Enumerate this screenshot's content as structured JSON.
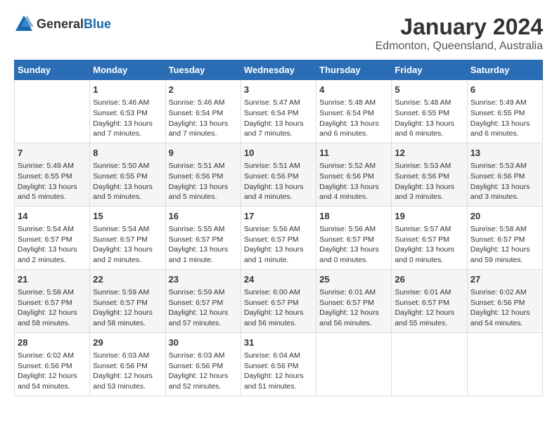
{
  "header": {
    "logo_general": "General",
    "logo_blue": "Blue",
    "title": "January 2024",
    "subtitle": "Edmonton, Queensland, Australia"
  },
  "calendar": {
    "days_of_week": [
      "Sunday",
      "Monday",
      "Tuesday",
      "Wednesday",
      "Thursday",
      "Friday",
      "Saturday"
    ],
    "weeks": [
      [
        {
          "day": "",
          "info": ""
        },
        {
          "day": "1",
          "info": "Sunrise: 5:46 AM\nSunset: 6:53 PM\nDaylight: 13 hours\nand 7 minutes."
        },
        {
          "day": "2",
          "info": "Sunrise: 5:46 AM\nSunset: 6:54 PM\nDaylight: 13 hours\nand 7 minutes."
        },
        {
          "day": "3",
          "info": "Sunrise: 5:47 AM\nSunset: 6:54 PM\nDaylight: 13 hours\nand 7 minutes."
        },
        {
          "day": "4",
          "info": "Sunrise: 5:48 AM\nSunset: 6:54 PM\nDaylight: 13 hours\nand 6 minutes."
        },
        {
          "day": "5",
          "info": "Sunrise: 5:48 AM\nSunset: 6:55 PM\nDaylight: 13 hours\nand 6 minutes."
        },
        {
          "day": "6",
          "info": "Sunrise: 5:49 AM\nSunset: 6:55 PM\nDaylight: 13 hours\nand 6 minutes."
        }
      ],
      [
        {
          "day": "7",
          "info": "Sunrise: 5:49 AM\nSunset: 6:55 PM\nDaylight: 13 hours\nand 5 minutes."
        },
        {
          "day": "8",
          "info": "Sunrise: 5:50 AM\nSunset: 6:55 PM\nDaylight: 13 hours\nand 5 minutes."
        },
        {
          "day": "9",
          "info": "Sunrise: 5:51 AM\nSunset: 6:56 PM\nDaylight: 13 hours\nand 5 minutes."
        },
        {
          "day": "10",
          "info": "Sunrise: 5:51 AM\nSunset: 6:56 PM\nDaylight: 13 hours\nand 4 minutes."
        },
        {
          "day": "11",
          "info": "Sunrise: 5:52 AM\nSunset: 6:56 PM\nDaylight: 13 hours\nand 4 minutes."
        },
        {
          "day": "12",
          "info": "Sunrise: 5:53 AM\nSunset: 6:56 PM\nDaylight: 13 hours\nand 3 minutes."
        },
        {
          "day": "13",
          "info": "Sunrise: 5:53 AM\nSunset: 6:56 PM\nDaylight: 13 hours\nand 3 minutes."
        }
      ],
      [
        {
          "day": "14",
          "info": "Sunrise: 5:54 AM\nSunset: 6:57 PM\nDaylight: 13 hours\nand 2 minutes."
        },
        {
          "day": "15",
          "info": "Sunrise: 5:54 AM\nSunset: 6:57 PM\nDaylight: 13 hours\nand 2 minutes."
        },
        {
          "day": "16",
          "info": "Sunrise: 5:55 AM\nSunset: 6:57 PM\nDaylight: 13 hours\nand 1 minute."
        },
        {
          "day": "17",
          "info": "Sunrise: 5:56 AM\nSunset: 6:57 PM\nDaylight: 13 hours\nand 1 minute."
        },
        {
          "day": "18",
          "info": "Sunrise: 5:56 AM\nSunset: 6:57 PM\nDaylight: 13 hours\nand 0 minutes."
        },
        {
          "day": "19",
          "info": "Sunrise: 5:57 AM\nSunset: 6:57 PM\nDaylight: 13 hours\nand 0 minutes."
        },
        {
          "day": "20",
          "info": "Sunrise: 5:58 AM\nSunset: 6:57 PM\nDaylight: 12 hours\nand 59 minutes."
        }
      ],
      [
        {
          "day": "21",
          "info": "Sunrise: 5:58 AM\nSunset: 6:57 PM\nDaylight: 12 hours\nand 58 minutes."
        },
        {
          "day": "22",
          "info": "Sunrise: 5:59 AM\nSunset: 6:57 PM\nDaylight: 12 hours\nand 58 minutes."
        },
        {
          "day": "23",
          "info": "Sunrise: 5:59 AM\nSunset: 6:57 PM\nDaylight: 12 hours\nand 57 minutes."
        },
        {
          "day": "24",
          "info": "Sunrise: 6:00 AM\nSunset: 6:57 PM\nDaylight: 12 hours\nand 56 minutes."
        },
        {
          "day": "25",
          "info": "Sunrise: 6:01 AM\nSunset: 6:57 PM\nDaylight: 12 hours\nand 56 minutes."
        },
        {
          "day": "26",
          "info": "Sunrise: 6:01 AM\nSunset: 6:57 PM\nDaylight: 12 hours\nand 55 minutes."
        },
        {
          "day": "27",
          "info": "Sunrise: 6:02 AM\nSunset: 6:56 PM\nDaylight: 12 hours\nand 54 minutes."
        }
      ],
      [
        {
          "day": "28",
          "info": "Sunrise: 6:02 AM\nSunset: 6:56 PM\nDaylight: 12 hours\nand 54 minutes."
        },
        {
          "day": "29",
          "info": "Sunrise: 6:03 AM\nSunset: 6:56 PM\nDaylight: 12 hours\nand 53 minutes."
        },
        {
          "day": "30",
          "info": "Sunrise: 6:03 AM\nSunset: 6:56 PM\nDaylight: 12 hours\nand 52 minutes."
        },
        {
          "day": "31",
          "info": "Sunrise: 6:04 AM\nSunset: 6:56 PM\nDaylight: 12 hours\nand 51 minutes."
        },
        {
          "day": "",
          "info": ""
        },
        {
          "day": "",
          "info": ""
        },
        {
          "day": "",
          "info": ""
        }
      ]
    ]
  }
}
